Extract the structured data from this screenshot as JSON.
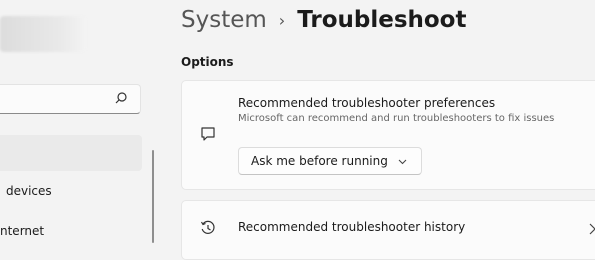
{
  "sidebar": {
    "search": {
      "placeholder": ""
    },
    "items": [
      {
        "label": "devices"
      },
      {
        "label": "nternet"
      }
    ]
  },
  "header": {
    "parent": "System",
    "separator": "›",
    "current": "Troubleshoot"
  },
  "main": {
    "section_title": "Options",
    "cards": [
      {
        "title": "Recommended troubleshooter preferences",
        "subtitle": "Microsoft can recommend and run troubleshooters to fix issues",
        "icon": "chat-bubble-icon",
        "dropdown": {
          "selected": "Ask me before running"
        }
      },
      {
        "title": "Recommended troubleshooter history",
        "icon": "history-icon"
      }
    ]
  }
}
